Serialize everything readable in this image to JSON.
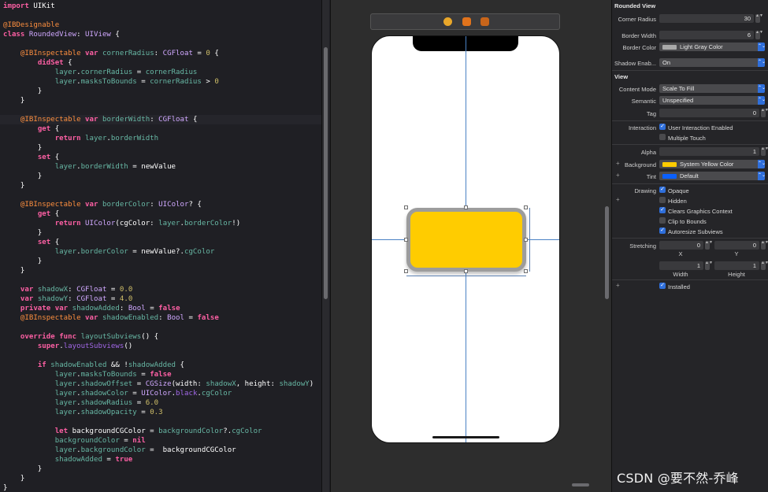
{
  "code_lines": [
    [
      [
        "kw",
        "import"
      ],
      [
        "pl",
        " UIKit"
      ]
    ],
    [],
    [
      [
        "at",
        "@IBDesignable"
      ]
    ],
    [
      [
        "kw",
        "class"
      ],
      [
        "pl",
        " "
      ],
      [
        "ty",
        "RoundedView"
      ],
      [
        "pl",
        ": "
      ],
      [
        "ty",
        "UIView"
      ],
      [
        "pl",
        " {"
      ]
    ],
    [],
    [
      [
        "pl",
        "    "
      ],
      [
        "at",
        "@IBInspectable"
      ],
      [
        "pl",
        " "
      ],
      [
        "kw",
        "var"
      ],
      [
        "pl",
        " "
      ],
      [
        "fn",
        "cornerRadius"
      ],
      [
        "pl",
        ": "
      ],
      [
        "ty",
        "CGFloat"
      ],
      [
        "pl",
        " = "
      ],
      [
        "nu",
        "0"
      ],
      [
        "pl",
        " {"
      ]
    ],
    [
      [
        "pl",
        "        "
      ],
      [
        "kw",
        "didSet"
      ],
      [
        "pl",
        " {"
      ]
    ],
    [
      [
        "pl",
        "            "
      ],
      [
        "fn",
        "layer"
      ],
      [
        "pl",
        "."
      ],
      [
        "fn",
        "cornerRadius"
      ],
      [
        "pl",
        " = "
      ],
      [
        "fn",
        "cornerRadius"
      ]
    ],
    [
      [
        "pl",
        "            "
      ],
      [
        "fn",
        "layer"
      ],
      [
        "pl",
        "."
      ],
      [
        "fn",
        "masksToBounds"
      ],
      [
        "pl",
        " = "
      ],
      [
        "fn",
        "cornerRadius"
      ],
      [
        "pl",
        " > "
      ],
      [
        "nu",
        "0"
      ]
    ],
    [
      [
        "pl",
        "        }"
      ]
    ],
    [
      [
        "pl",
        "    }"
      ]
    ],
    [],
    [
      [
        "pl",
        "    "
      ],
      [
        "at",
        "@IBInspectable"
      ],
      [
        "pl",
        " "
      ],
      [
        "kw",
        "var"
      ],
      [
        "pl",
        " "
      ],
      [
        "fn",
        "borderWidth"
      ],
      [
        "pl",
        ": "
      ],
      [
        "ty",
        "CGFloat"
      ],
      [
        "pl",
        " {"
      ]
    ],
    [
      [
        "pl",
        "        "
      ],
      [
        "kw",
        "get"
      ],
      [
        "pl",
        " {"
      ]
    ],
    [
      [
        "pl",
        "            "
      ],
      [
        "kw",
        "return"
      ],
      [
        "pl",
        " "
      ],
      [
        "fn",
        "layer"
      ],
      [
        "pl",
        "."
      ],
      [
        "fn",
        "borderWidth"
      ]
    ],
    [
      [
        "pl",
        "        }"
      ]
    ],
    [
      [
        "pl",
        "        "
      ],
      [
        "kw",
        "set"
      ],
      [
        "pl",
        " {"
      ]
    ],
    [
      [
        "pl",
        "            "
      ],
      [
        "fn",
        "layer"
      ],
      [
        "pl",
        "."
      ],
      [
        "fn",
        "borderWidth"
      ],
      [
        "pl",
        " = newValue"
      ]
    ],
    [
      [
        "pl",
        "        }"
      ]
    ],
    [
      [
        "pl",
        "    }"
      ]
    ],
    [],
    [
      [
        "pl",
        "    "
      ],
      [
        "at",
        "@IBInspectable"
      ],
      [
        "pl",
        " "
      ],
      [
        "kw",
        "var"
      ],
      [
        "pl",
        " "
      ],
      [
        "fn",
        "borderColor"
      ],
      [
        "pl",
        ": "
      ],
      [
        "ty",
        "UIColor"
      ],
      [
        "pl",
        "? {"
      ]
    ],
    [
      [
        "pl",
        "        "
      ],
      [
        "kw",
        "get"
      ],
      [
        "pl",
        " {"
      ]
    ],
    [
      [
        "pl",
        "            "
      ],
      [
        "kw",
        "return"
      ],
      [
        "pl",
        " "
      ],
      [
        "ty",
        "UIColor"
      ],
      [
        "pl",
        "(cgColor: "
      ],
      [
        "fn",
        "layer"
      ],
      [
        "pl",
        "."
      ],
      [
        "fn",
        "borderColor"
      ],
      [
        "pl",
        "!)"
      ]
    ],
    [
      [
        "pl",
        "        }"
      ]
    ],
    [
      [
        "pl",
        "        "
      ],
      [
        "kw",
        "set"
      ],
      [
        "pl",
        " {"
      ]
    ],
    [
      [
        "pl",
        "            "
      ],
      [
        "fn",
        "layer"
      ],
      [
        "pl",
        "."
      ],
      [
        "fn",
        "borderColor"
      ],
      [
        "pl",
        " = newValue?."
      ],
      [
        "fn",
        "cgColor"
      ]
    ],
    [
      [
        "pl",
        "        }"
      ]
    ],
    [
      [
        "pl",
        "    }"
      ]
    ],
    [],
    [
      [
        "pl",
        "    "
      ],
      [
        "kw",
        "var"
      ],
      [
        "pl",
        " "
      ],
      [
        "fn",
        "shadowX"
      ],
      [
        "pl",
        ": "
      ],
      [
        "ty",
        "CGFloat"
      ],
      [
        "pl",
        " = "
      ],
      [
        "nu",
        "0.0"
      ]
    ],
    [
      [
        "pl",
        "    "
      ],
      [
        "kw",
        "var"
      ],
      [
        "pl",
        " "
      ],
      [
        "fn",
        "shadowY"
      ],
      [
        "pl",
        ": "
      ],
      [
        "ty",
        "CGFloat"
      ],
      [
        "pl",
        " = "
      ],
      [
        "nu",
        "4.0"
      ]
    ],
    [
      [
        "pl",
        "    "
      ],
      [
        "kw",
        "private"
      ],
      [
        "pl",
        " "
      ],
      [
        "kw",
        "var"
      ],
      [
        "pl",
        " "
      ],
      [
        "fn",
        "shadowAdded"
      ],
      [
        "pl",
        ": "
      ],
      [
        "ty",
        "Bool"
      ],
      [
        "pl",
        " = "
      ],
      [
        "kw",
        "false"
      ]
    ],
    [
      [
        "pl",
        "    "
      ],
      [
        "at",
        "@IBInspectable"
      ],
      [
        "pl",
        " "
      ],
      [
        "kw",
        "var"
      ],
      [
        "pl",
        " "
      ],
      [
        "fn",
        "shadowEnabled"
      ],
      [
        "pl",
        ": "
      ],
      [
        "ty",
        "Bool"
      ],
      [
        "pl",
        " = "
      ],
      [
        "kw",
        "false"
      ]
    ],
    [],
    [
      [
        "pl",
        "    "
      ],
      [
        "kw",
        "override"
      ],
      [
        "pl",
        " "
      ],
      [
        "kw",
        "func"
      ],
      [
        "pl",
        " "
      ],
      [
        "fn",
        "layoutSubviews"
      ],
      [
        "pl",
        "() {"
      ]
    ],
    [
      [
        "pl",
        "        "
      ],
      [
        "kw",
        "super"
      ],
      [
        "pl",
        "."
      ],
      [
        "lib",
        "layoutSubviews"
      ],
      [
        "pl",
        "()"
      ]
    ],
    [],
    [
      [
        "pl",
        "        "
      ],
      [
        "kw",
        "if"
      ],
      [
        "pl",
        " "
      ],
      [
        "fn",
        "shadowEnabled"
      ],
      [
        "pl",
        " && !"
      ],
      [
        "fn",
        "shadowAdded"
      ],
      [
        "pl",
        " {"
      ]
    ],
    [
      [
        "pl",
        "            "
      ],
      [
        "fn",
        "layer"
      ],
      [
        "pl",
        "."
      ],
      [
        "fn",
        "masksToBounds"
      ],
      [
        "pl",
        " = "
      ],
      [
        "kw",
        "false"
      ]
    ],
    [
      [
        "pl",
        "            "
      ],
      [
        "fn",
        "layer"
      ],
      [
        "pl",
        "."
      ],
      [
        "fn",
        "shadowOffset"
      ],
      [
        "pl",
        " = "
      ],
      [
        "ty",
        "CGSize"
      ],
      [
        "pl",
        "(width: "
      ],
      [
        "fn",
        "shadowX"
      ],
      [
        "pl",
        ", height: "
      ],
      [
        "fn",
        "shadowY"
      ],
      [
        "pl",
        ")"
      ]
    ],
    [
      [
        "pl",
        "            "
      ],
      [
        "fn",
        "layer"
      ],
      [
        "pl",
        "."
      ],
      [
        "fn",
        "shadowColor"
      ],
      [
        "pl",
        " = "
      ],
      [
        "ty",
        "UIColor"
      ],
      [
        "pl",
        "."
      ],
      [
        "pr",
        "black"
      ],
      [
        "pl",
        "."
      ],
      [
        "fn",
        "cgColor"
      ]
    ],
    [
      [
        "pl",
        "            "
      ],
      [
        "fn",
        "layer"
      ],
      [
        "pl",
        "."
      ],
      [
        "fn",
        "shadowRadius"
      ],
      [
        "pl",
        " = "
      ],
      [
        "nu",
        "6.0"
      ]
    ],
    [
      [
        "pl",
        "            "
      ],
      [
        "fn",
        "layer"
      ],
      [
        "pl",
        "."
      ],
      [
        "fn",
        "shadowOpacity"
      ],
      [
        "pl",
        " = "
      ],
      [
        "nu",
        "0.3"
      ]
    ],
    [],
    [
      [
        "pl",
        "            "
      ],
      [
        "kw",
        "let"
      ],
      [
        "pl",
        " backgroundCGColor = "
      ],
      [
        "fn",
        "backgroundColor"
      ],
      [
        "pl",
        "?."
      ],
      [
        "fn",
        "cgColor"
      ]
    ],
    [
      [
        "pl",
        "            "
      ],
      [
        "fn",
        "backgroundColor"
      ],
      [
        "pl",
        " = "
      ],
      [
        "kw",
        "nil"
      ]
    ],
    [
      [
        "pl",
        "            "
      ],
      [
        "fn",
        "layer"
      ],
      [
        "pl",
        "."
      ],
      [
        "fn",
        "backgroundColor"
      ],
      [
        "pl",
        " =  backgroundCGColor"
      ]
    ],
    [
      [
        "pl",
        "            "
      ],
      [
        "fn",
        "shadowAdded"
      ],
      [
        "pl",
        " = "
      ],
      [
        "kw",
        "true"
      ]
    ],
    [
      [
        "pl",
        "        }"
      ]
    ],
    [
      [
        "pl",
        "    }"
      ]
    ],
    [
      [
        "pl",
        "}"
      ]
    ]
  ],
  "highlighted_line": 12,
  "inspector": {
    "section_title": "Rounded View",
    "corner_radius_label": "Corner Radius",
    "corner_radius_value": "30",
    "border_width_label": "Border Width",
    "border_width_value": "6",
    "border_color_label": "Border Color",
    "border_color_value": "Light Gray Color",
    "border_color_swatch": "#a9a9a9",
    "shadow_label": "Shadow Enab...",
    "shadow_value": "On",
    "view_section": "View",
    "content_mode_label": "Content Mode",
    "content_mode_value": "Scale To Fill",
    "semantic_label": "Semantic",
    "semantic_value": "Unspecified",
    "tag_label": "Tag",
    "tag_value": "0",
    "interaction_label": "Interaction",
    "user_interaction_label": "User Interaction Enabled",
    "multiple_touch_label": "Multiple Touch",
    "alpha_label": "Alpha",
    "alpha_value": "1",
    "background_label": "Background",
    "background_value": "System Yellow Color",
    "background_swatch": "#ffcc00",
    "tint_label": "Tint",
    "tint_value": "Default",
    "tint_swatch": "#0a60ff",
    "drawing_label": "Drawing",
    "opaque_label": "Opaque",
    "hidden_label": "Hidden",
    "clears_label": "Clears Graphics Context",
    "clip_label": "Clip to Bounds",
    "autoresize_label": "Autoresize Subviews",
    "stretching_label": "Stretching",
    "stretch_x": "0",
    "stretch_y": "0",
    "stretch_width": "1",
    "stretch_height": "1",
    "x_label": "X",
    "y_label": "Y",
    "width_label": "Width",
    "height_label": "Height",
    "installed_label": "Installed",
    "plus_sign": "+",
    "check_mark": "✓",
    "stepper_arrows": "▲▼",
    "popup_arrows": "⌃⌄"
  },
  "watermark": "CSDN @要不然-乔峰",
  "colors": {
    "view_fill": "#ffcc00",
    "view_border": "#9c9c9c",
    "guide": "#4a82c4",
    "accent": "#2f6fdb"
  }
}
